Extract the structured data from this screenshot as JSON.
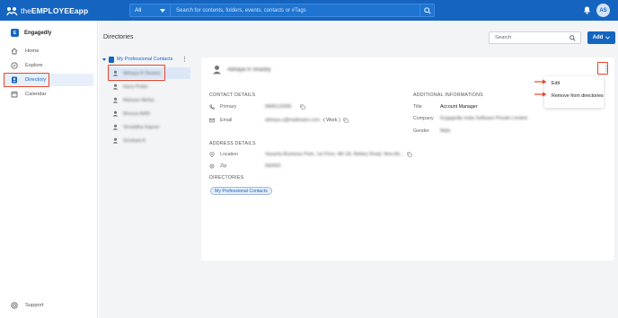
{
  "app": {
    "logo_prefix": "the",
    "logo_name": "EMPLOYEEapp",
    "search_scope": "All",
    "search_placeholder": "Search for contents, folders, events, contacts or #Tags",
    "avatar_initials": "AS"
  },
  "sidebar": {
    "org": "Engagedly",
    "items": [
      {
        "label": "Home",
        "icon": "home-icon"
      },
      {
        "label": "Explore",
        "icon": "compass-icon"
      },
      {
        "label": "Directory",
        "icon": "directory-icon",
        "active": true
      },
      {
        "label": "Calendar",
        "icon": "calendar-icon"
      }
    ],
    "support": "Support"
  },
  "page": {
    "title": "Directories",
    "search_placeholder": "Search",
    "add_label": "Add"
  },
  "directories": {
    "name": "My Professional Contacts",
    "contacts": [
      "Abhaya N Shastry",
      "Harry Potter",
      "Mahaan Mehta",
      "Mourya Adith",
      "Shraddha Kapoor",
      "Sreekala K"
    ],
    "selected_index": 0
  },
  "contact": {
    "name": "Abhaya N Shastry",
    "contact_details_title": "CONTACT DETAILS",
    "primary_label": "Primary",
    "primary_value": "9845123456",
    "email_label": "Email",
    "email_value": "abhaya.s@mailinator.com",
    "email_type": "( Work )",
    "additional_title": "ADDITIONAL INFORMATIONS",
    "title_label": "Title",
    "title_value": "Account Manager",
    "company_label": "Company",
    "company_value": "Engagedly India Software Private Limited",
    "gender_label": "Gender",
    "gender_value": "Male",
    "address_title": "ADDRESS DETAILS",
    "location_label": "Location",
    "location_value": "Vasanta Business Park, 1st Floor, 4th 2A, Bellary Road, New Air...",
    "zip_label": "Zip",
    "zip_value": "560092",
    "directories_title": "DIRECTORIES",
    "directory_chip": "My Professional Contacts"
  },
  "menu": {
    "items": [
      "Edit",
      "Remove from directories"
    ]
  },
  "colors": {
    "brand": "#1565c0",
    "highlight": "#e8442b"
  }
}
